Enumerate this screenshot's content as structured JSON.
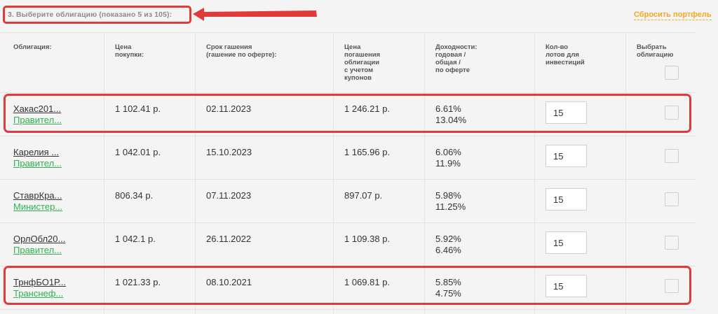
{
  "header": {
    "step_title": "3. Выберите облигацию (показано 5 из 105):",
    "reset_link": "Сбросить портфель"
  },
  "columns": {
    "bond": "Облигация:",
    "buy_price": "Цена\nпокупки:",
    "maturity": "Срок гашения\n(гашение по оферте):",
    "redemption": "Цена\nпогашения\nоблигации\nс учетом\nкупонов",
    "yield": "Доходности:\nгодовая /\nобщая /\nпо оферте",
    "lots": "Кол-во\nлотов для\nинвестиций",
    "select": "Выбрать\nоблигацию"
  },
  "rows": [
    {
      "name": "Хакас201...",
      "issuer": "Правител...",
      "buy_price": "1 102.41 р.",
      "maturity": "02.11.2023",
      "redemption": "1 246.21 р.",
      "yield_annual": "6.61%",
      "yield_total": "13.04%",
      "lots": "15"
    },
    {
      "name": "Карелия ...",
      "issuer": "Правител...",
      "buy_price": "1 042.01 р.",
      "maturity": "15.10.2023",
      "redemption": "1 165.96 р.",
      "yield_annual": "6.06%",
      "yield_total": "11.9%",
      "lots": "15"
    },
    {
      "name": "СтаврКра...",
      "issuer": "Министер...",
      "buy_price": "806.34 р.",
      "maturity": "07.11.2023",
      "redemption": "897.07 р.",
      "yield_annual": "5.98%",
      "yield_total": "11.25%",
      "lots": "15"
    },
    {
      "name": "ОрлОбл20...",
      "issuer": "Правител...",
      "buy_price": "1 042.1 р.",
      "maturity": "26.11.2022",
      "redemption": "1 109.38 р.",
      "yield_annual": "5.92%",
      "yield_total": "6.46%",
      "lots": "15"
    },
    {
      "name": "ТрнфБО1Р...",
      "issuer": "Транснеф...",
      "buy_price": "1 021.33 р.",
      "maturity": "08.10.2021",
      "redemption": "1 069.81 р.",
      "yield_annual": "5.85%",
      "yield_total": "4.75%",
      "lots": "15"
    }
  ],
  "colors": {
    "accent_red": "#e03a3a",
    "link_green": "#2eb34e",
    "reset_orange": "#f5a623"
  }
}
